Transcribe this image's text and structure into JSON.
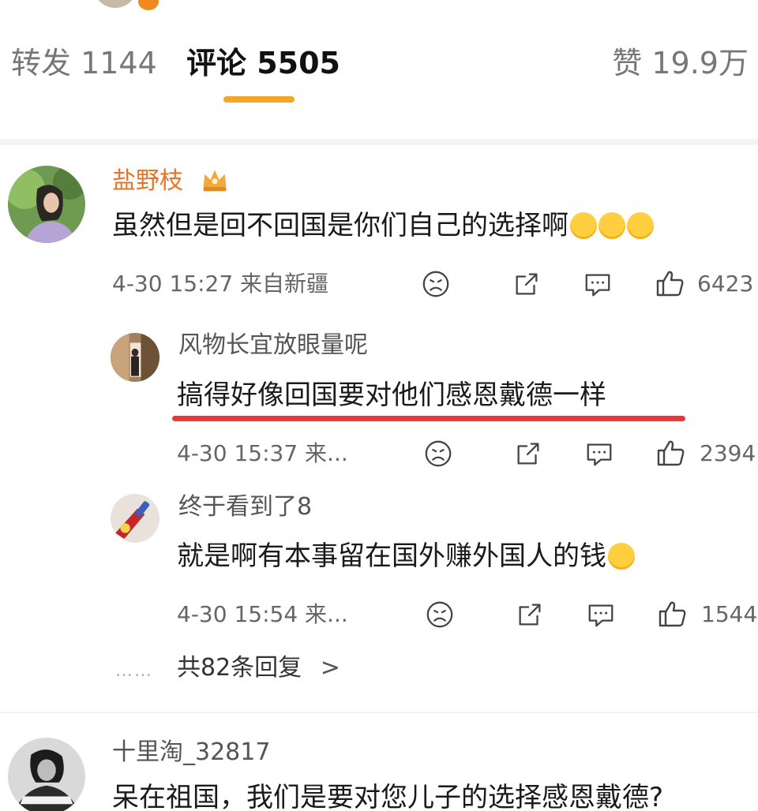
{
  "tabs": {
    "repost_label": "转发 1144",
    "comments_label": "评论 5505",
    "likes_label": "赞 19.9万"
  },
  "comments": [
    {
      "user": "盐野枝",
      "text": "虽然但是回不回国是你们自己的选择啊",
      "meta": "4-30 15:27 来自新疆",
      "likes": "6423"
    },
    {
      "user": "十里淘_32817",
      "text": "呆在祖国，我们是要对您儿子的选择感恩戴德?"
    }
  ],
  "replies": [
    {
      "user": "风物长宜放眼量呢",
      "text": "搞得好像回国要对他们感恩戴德一样",
      "meta": "4-30 15:37 来...",
      "likes": "2394"
    },
    {
      "user": "终于看到了8",
      "text": "就是啊有本事留在国外赚外国人的钱",
      "meta": "4-30 15:54 来...",
      "likes": "1544"
    }
  ],
  "more_replies": {
    "dots": "……",
    "label": "共82条回复",
    "chevron": ">"
  },
  "icons": {
    "dislike": "frown-face-icon",
    "share": "share-icon",
    "comment": "comment-bubble-icon",
    "like": "thumbs-up-icon"
  },
  "colors": {
    "accent_tab": "#f5a623",
    "username": "#e8742a",
    "highlight_underline": "#e8383d"
  }
}
